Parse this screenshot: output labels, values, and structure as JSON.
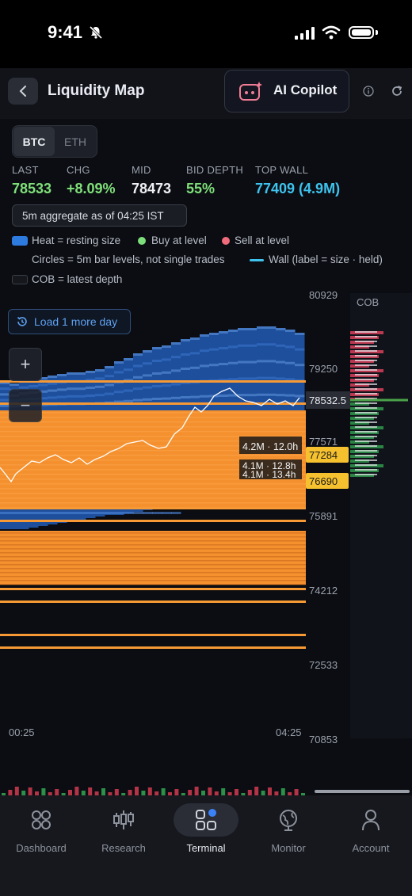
{
  "status_bar": {
    "time": "9:41"
  },
  "header": {
    "title": "Liquidity Map",
    "copilot_label": "AI Copilot"
  },
  "asset_tabs": {
    "active": "BTC",
    "inactive": "ETH"
  },
  "stats": [
    {
      "label": "LAST",
      "value": "78533",
      "color": "#7fe07a"
    },
    {
      "label": "CHG",
      "value": "+8.09%",
      "color": "#7fe07a"
    },
    {
      "label": "MID",
      "value": "78473",
      "color": "#eef0f4"
    },
    {
      "label": "BID DEPTH",
      "value": "55%",
      "color": "#7fe07a"
    },
    {
      "label": "TOP WALL",
      "value": "77409 (4.9M)",
      "color": "#3ec3ee"
    }
  ],
  "aggregate": "5m aggregate  as of 04:25 IST",
  "legend": {
    "heat": "Heat = resting size",
    "buy": "Buy at level",
    "sell": "Sell at level",
    "circles": "Circles = 5m bar levels, not single trades",
    "wall": "Wall (label = size · held)",
    "cob": "COB = latest depth"
  },
  "chart": {
    "load_more": "Load 1 more day",
    "zoom_in": "+",
    "zoom_out": "−",
    "cob_label": "COB",
    "y_ticks": [
      "80929",
      "79250",
      "77571",
      "75891",
      "74212",
      "72533",
      "70853"
    ],
    "x_ticks": [
      "00:25",
      "04:25"
    ],
    "current_price": "78532.5",
    "price_tags": [
      "77284",
      "76690"
    ],
    "wall_labels": [
      "4.2M · 12.0h",
      "4.1M · 12.8h",
      "4.1M · 13.4h"
    ]
  },
  "nav": [
    {
      "label": "Dashboard",
      "icon": "dashboard-icon"
    },
    {
      "label": "Research",
      "icon": "candles-icon"
    },
    {
      "label": "Terminal",
      "icon": "terminal-grid-icon"
    },
    {
      "label": "Monitor",
      "icon": "globe-icon"
    },
    {
      "label": "Account",
      "icon": "person-icon"
    }
  ],
  "colors": {
    "accent_blue": "#2e7be0",
    "wall_orange": "#f79a35",
    "buy": "#7fe07a",
    "sell": "#f06b7c",
    "cyan": "#3ec3ee"
  }
}
